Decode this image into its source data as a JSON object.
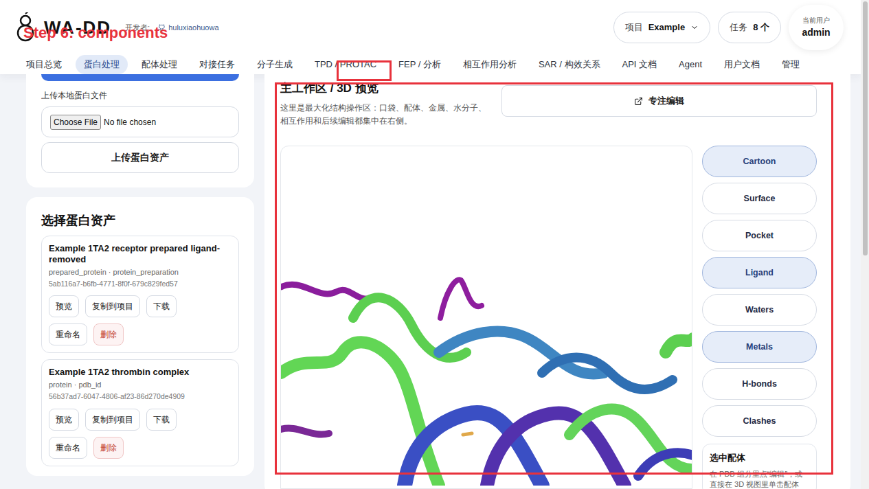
{
  "annotation": {
    "label": "Step 6: components"
  },
  "header": {
    "logo": "WA-DD",
    "developer_label": "开发者:",
    "developer": "huluxiaohuowa",
    "project_label": "项目",
    "project": "Example",
    "tasks_label": "任务",
    "tasks_count": "8 个",
    "user_label": "当前用户",
    "user": "admin"
  },
  "nav": [
    {
      "label": "项目总览",
      "selected": false
    },
    {
      "label": "蛋白处理",
      "selected": true
    },
    {
      "label": "配体处理",
      "selected": false
    },
    {
      "label": "对接任务",
      "selected": false
    },
    {
      "label": "分子生成",
      "selected": false
    },
    {
      "label": "TPD / PROTAC",
      "selected": false
    },
    {
      "label": "FEP / 分析",
      "selected": false
    },
    {
      "label": "相互作用分析",
      "selected": false
    },
    {
      "label": "SAR / 构效关系",
      "selected": false
    },
    {
      "label": "API 文档",
      "selected": false
    },
    {
      "label": "Agent",
      "selected": false
    },
    {
      "label": "用户文档",
      "selected": false
    },
    {
      "label": "管理",
      "selected": false
    }
  ],
  "upload": {
    "label": "上传本地蛋白文件",
    "file_button": "Choose File",
    "file_status": "No file chosen",
    "submit": "上传蛋白资产"
  },
  "assets": {
    "title": "选择蛋白资产",
    "items": [
      {
        "title": "Example 1TA2 receptor prepared ligand-removed",
        "meta": "prepared_protein · protein_preparation",
        "id": "5ab116a7-b6fb-4771-8f0f-679c829fed57",
        "actions": [
          {
            "label": "预览",
            "kind": "normal"
          },
          {
            "label": "复制到项目",
            "kind": "normal"
          },
          {
            "label": "下载",
            "kind": "normal"
          },
          {
            "label": "重命名",
            "kind": "normal"
          },
          {
            "label": "删除",
            "kind": "danger"
          }
        ]
      },
      {
        "title": "Example 1TA2 thrombin complex",
        "meta": "protein · pdb_id",
        "id": "56b37ad7-6047-4806-af23-86d270de4909",
        "actions": [
          {
            "label": "预览",
            "kind": "normal"
          },
          {
            "label": "复制到项目",
            "kind": "normal"
          },
          {
            "label": "下载",
            "kind": "normal"
          },
          {
            "label": "重命名",
            "kind": "normal"
          },
          {
            "label": "删除",
            "kind": "danger"
          }
        ]
      }
    ]
  },
  "workspace": {
    "title": "主工作区 / 3D 预览",
    "description": "这里是最大化结构操作区：口袋、配体、金属、水分子、相互作用和后续编辑都集中在右侧。",
    "focus_button": "专注编辑",
    "toggles": [
      {
        "label": "Cartoon",
        "selected": true
      },
      {
        "label": "Surface",
        "selected": false
      },
      {
        "label": "Pocket",
        "selected": false
      },
      {
        "label": "Ligand",
        "selected": true
      },
      {
        "label": "Waters",
        "selected": false
      },
      {
        "label": "Metals",
        "selected": true
      },
      {
        "label": "H-bonds",
        "selected": false
      },
      {
        "label": "Clashes",
        "selected": false
      }
    ],
    "selected_ligand": {
      "title": "选中配体",
      "hint": "在 PDB 组分里点“编辑”，或直接在 3D 视图里单击配体"
    }
  }
}
